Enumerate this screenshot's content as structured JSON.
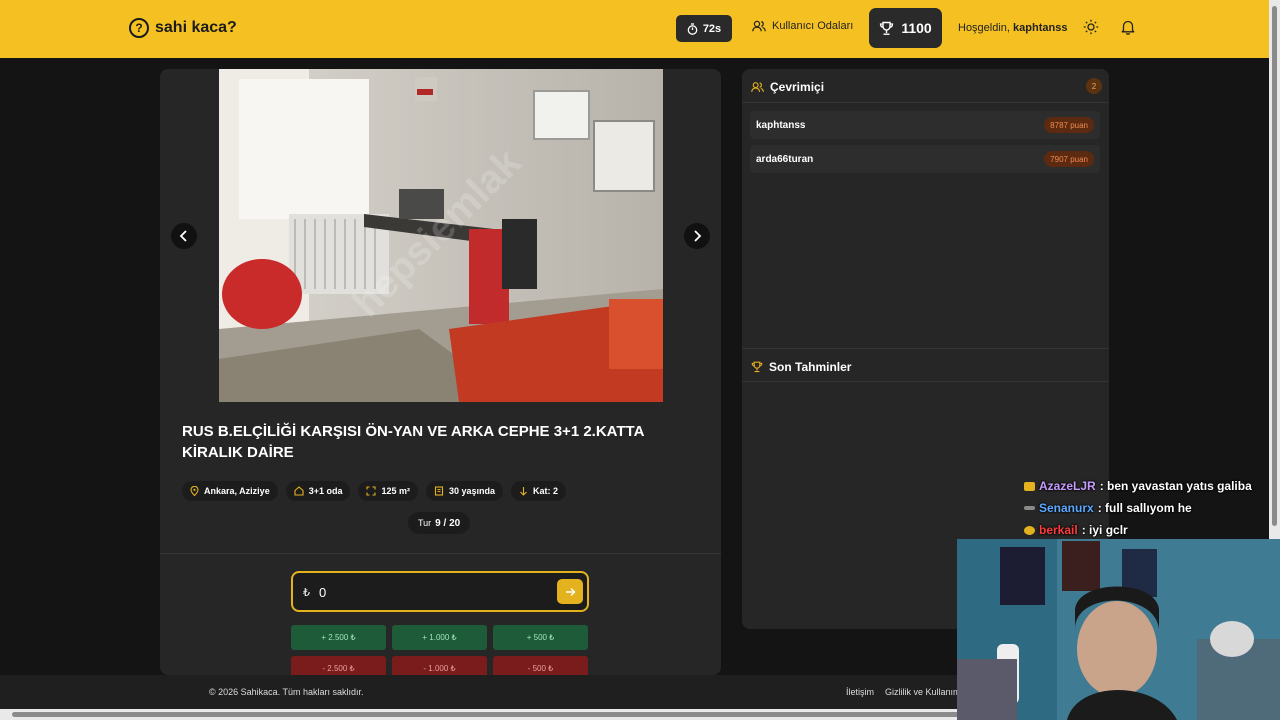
{
  "header": {
    "logo_text": "sahi kaca?",
    "timer": "72s",
    "rooms_label": "Kullanıcı Odaları",
    "score": "1100",
    "welcome_prefix": "Hoşgeldin,",
    "username": "kaphtanss"
  },
  "listing": {
    "title": "RUS B.ELÇİLİĞİ KARŞISI ÖN-YAN VE ARKA CEPHE 3+1 2.KATTA KİRALIK DAİRE",
    "tags": [
      {
        "icon": "location-pin-icon",
        "label": "Ankara, Aziziye"
      },
      {
        "icon": "home-icon",
        "label": "3+1 oda"
      },
      {
        "icon": "area-icon",
        "label": "125 m²"
      },
      {
        "icon": "building-icon",
        "label": "30 yaşında"
      },
      {
        "icon": "floor-arrow-icon",
        "label": "Kat: 2"
      }
    ],
    "round_label": "Tur",
    "round_value": "9 / 20"
  },
  "guess": {
    "currency": "₺",
    "value": "0"
  },
  "steps": {
    "plus": [
      "+ 2.500 ₺",
      "+ 1.000 ₺",
      "+ 500 ₺"
    ],
    "minus": [
      "- 2.500 ₺",
      "- 1.000 ₺",
      "- 500 ₺"
    ]
  },
  "online": {
    "title": "Çevrimiçi",
    "count": "2",
    "users": [
      {
        "name": "kaphtanss",
        "points": "8787 puan"
      },
      {
        "name": "arda66turan",
        "points": "7907 puan"
      }
    ]
  },
  "recent": {
    "title": "Son Tahminler"
  },
  "footer": {
    "copyright": "© 2026 Sahikaca. Tüm hakları saklıdır.",
    "links": [
      "İletişim",
      "Gizlilik ve Kullanım"
    ]
  },
  "stream_chat": [
    {
      "user": "AzazeLJR",
      "color": "#c79bff",
      "badge": "#e4b21e",
      "message": ": ben yavastan yatıs galiba"
    },
    {
      "user": "Senanurx",
      "color": "#5aa9ff",
      "badge": "#8a8a8a",
      "message": ": full sallıyom he"
    },
    {
      "user": "berkail",
      "color": "#ff3b3b",
      "badge": "#e4b21e",
      "message": ": iyi gclr"
    }
  ],
  "colors": {
    "accent": "#f5c122",
    "plus_button": "#1e5c39",
    "minus_button": "#7a1c1c"
  }
}
